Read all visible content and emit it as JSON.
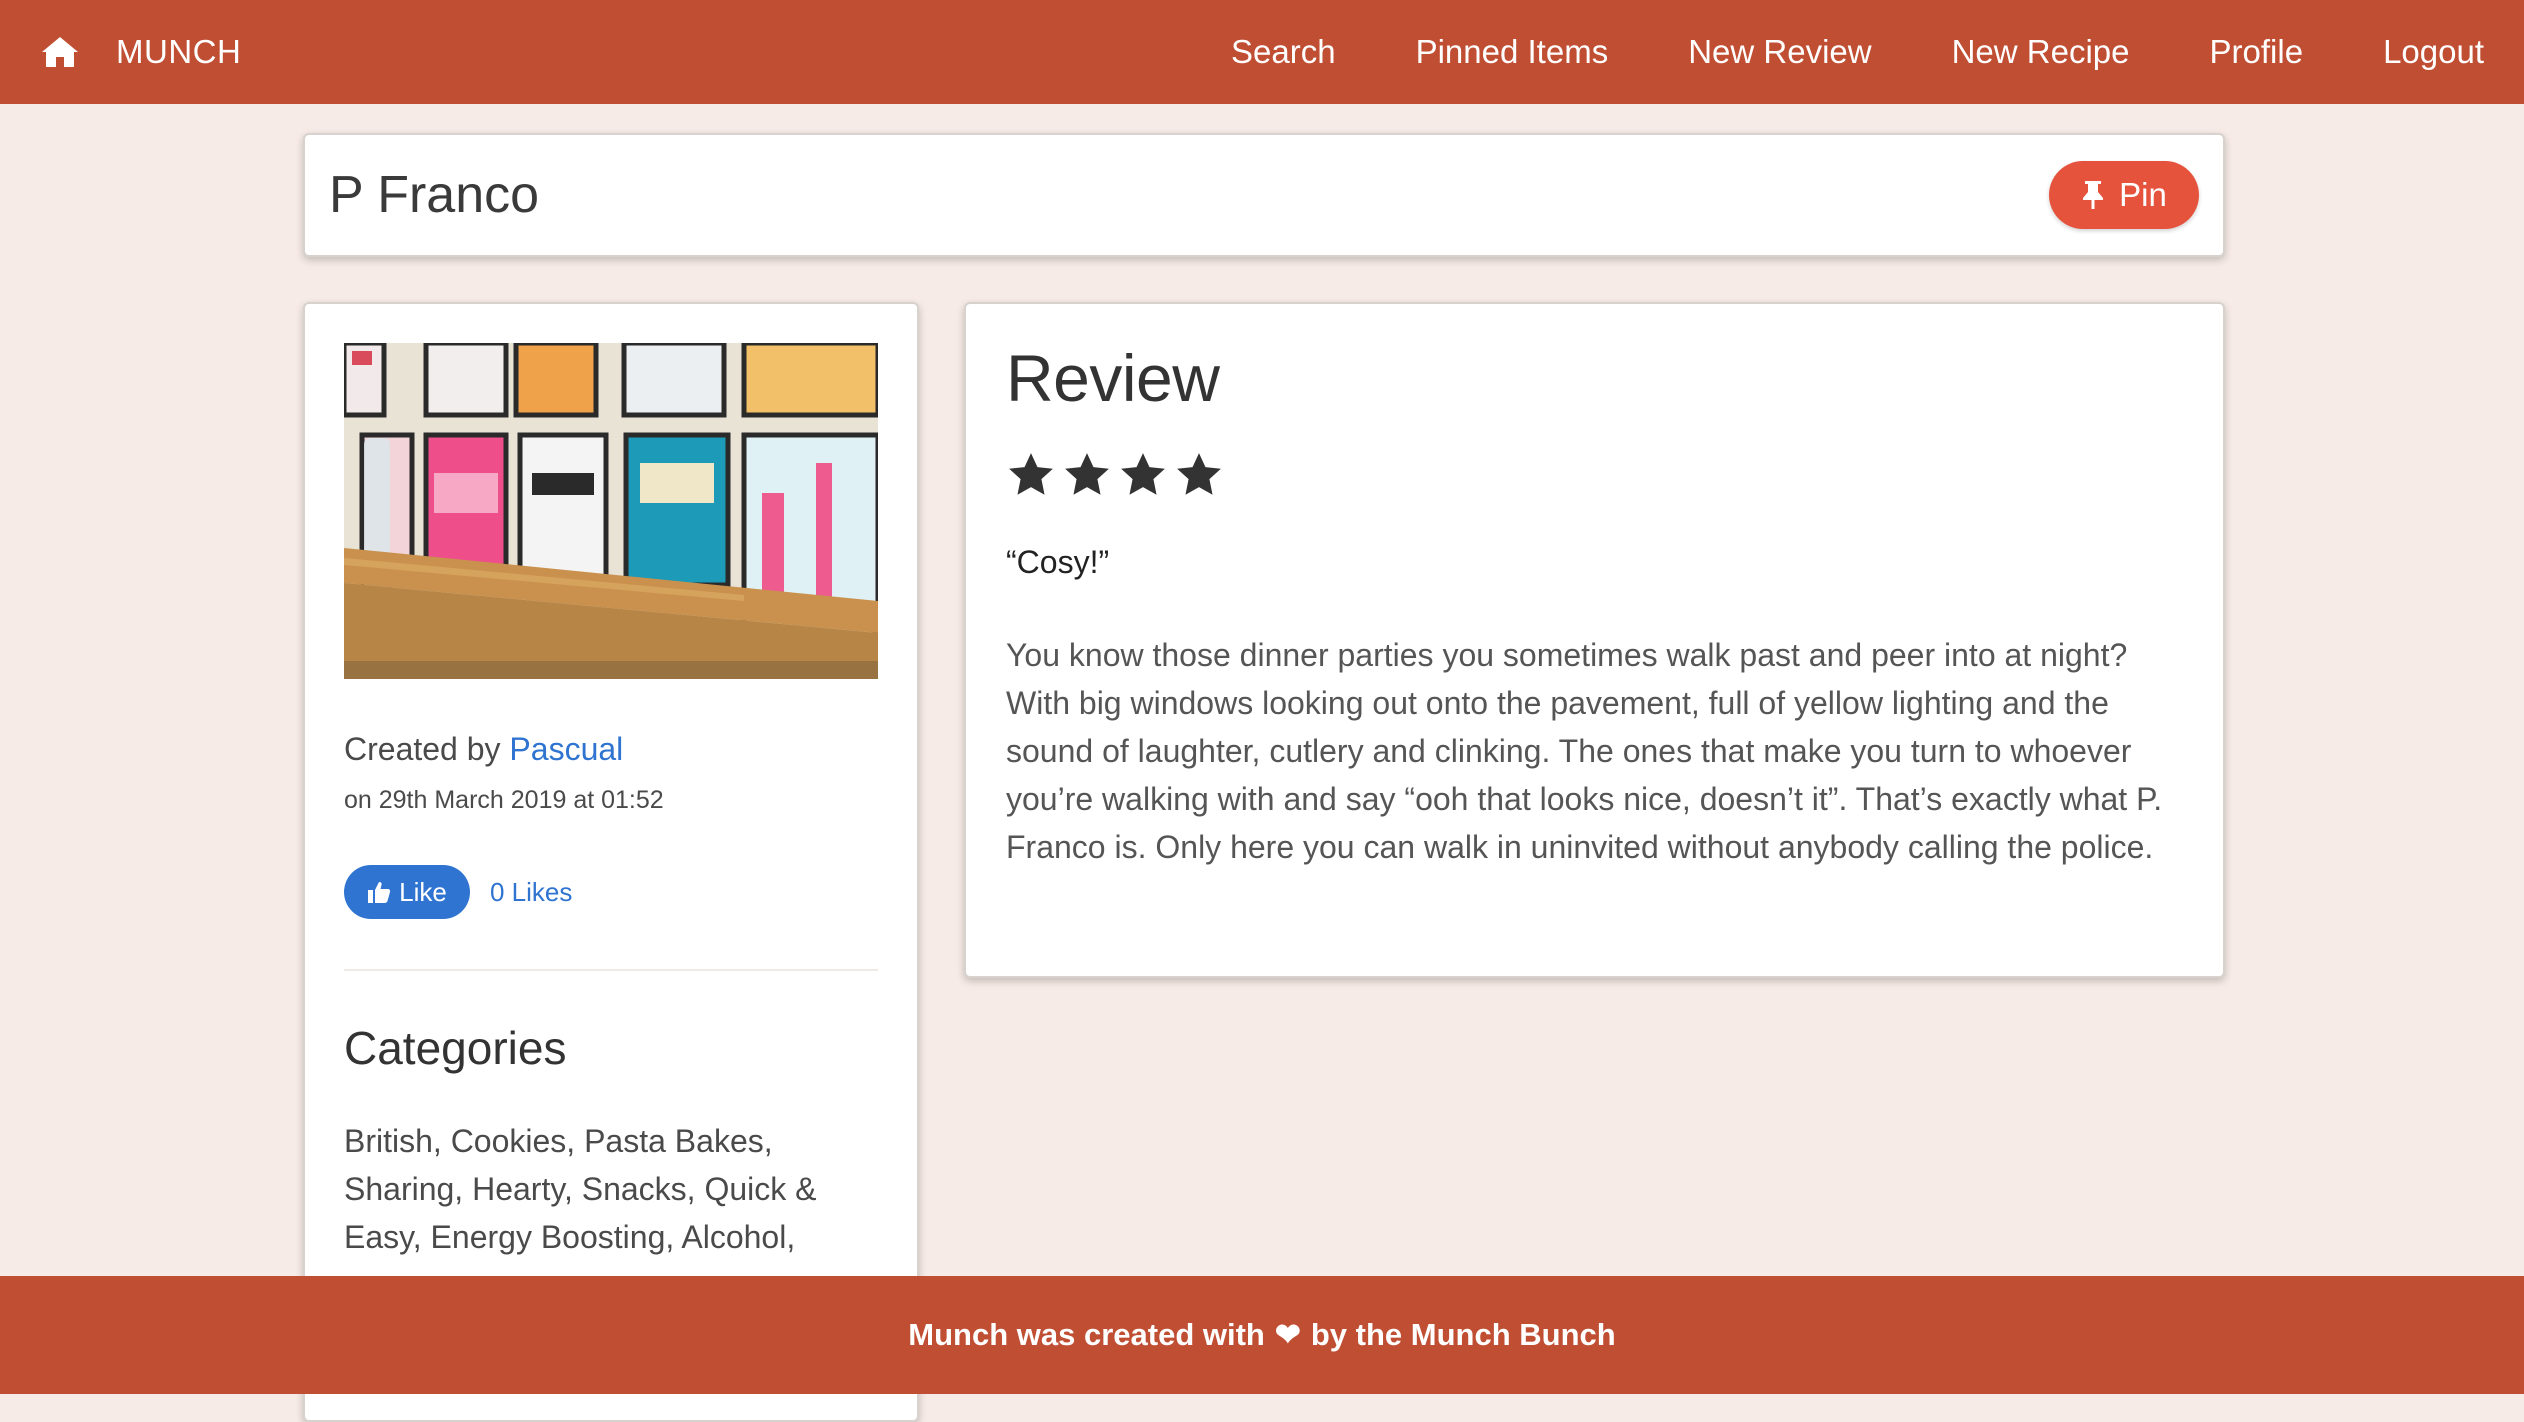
{
  "nav": {
    "brand": "MUNCH",
    "links": [
      "Search",
      "Pinned Items",
      "New Review",
      "New Recipe",
      "Profile",
      "Logout"
    ],
    "color": "#c04e33"
  },
  "header": {
    "title": "P Franco",
    "pin_label": "Pin",
    "pin_color": "#e5533d"
  },
  "sidebar": {
    "created_prefix": "Created by",
    "author": "Pascual",
    "created_date": "on 29th March 2019 at 01:52",
    "like_label": "Like",
    "likes_count": "0 Likes",
    "categories_heading": "Categories",
    "categories": "British, Cookies, Pasta Bakes, Sharing, Hearty, Snacks, Quick & Easy, Energy Boosting, Alcohol,",
    "link_color": "#2f74d0"
  },
  "review": {
    "heading": "Review",
    "rating": 4,
    "quote": "“Cosy!”",
    "body": "You know those dinner parties you sometimes walk past and peer into at night? With big windows looking out onto the pavement, full of yellow lighting and the sound of laughter, cutlery and clinking. The ones that make you turn to whoever you’re walking with and say “ooh that looks nice, doesn’t it”. That’s exactly what P. Franco is. Only here you can walk in uninvited without anybody calling the police."
  },
  "footer": {
    "text_before": "Munch was created with",
    "text_after": "by the Munch Bunch"
  }
}
